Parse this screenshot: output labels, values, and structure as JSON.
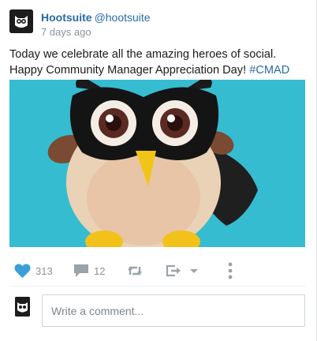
{
  "post": {
    "author_name": "Hootsuite",
    "author_handle": "@hootsuite",
    "timestamp": "7 days ago",
    "text_line1": "Today we celebrate all the amazing heroes of social.",
    "text_line2": "Happy Community Manager Appreciation Day!",
    "hashtag": "#CMAD",
    "image_alt": "Plush owl mascot wearing a black superhero mask and cape"
  },
  "actions": {
    "like_count": "313",
    "reply_count": "12",
    "like_icon": "heart-icon",
    "reply_icon": "speech-bubble-icon",
    "retweet_icon": "retweet-icon",
    "share_icon": "share-icon",
    "more_icon": "more-vertical-icon"
  },
  "comment": {
    "placeholder": "Write a comment..."
  },
  "colors": {
    "link": "#2a6ca6",
    "like": "#3a9fd8",
    "icon_gray": "#9aa3a8",
    "muted_text": "#8a9399",
    "image_background": "#36bcd0"
  }
}
